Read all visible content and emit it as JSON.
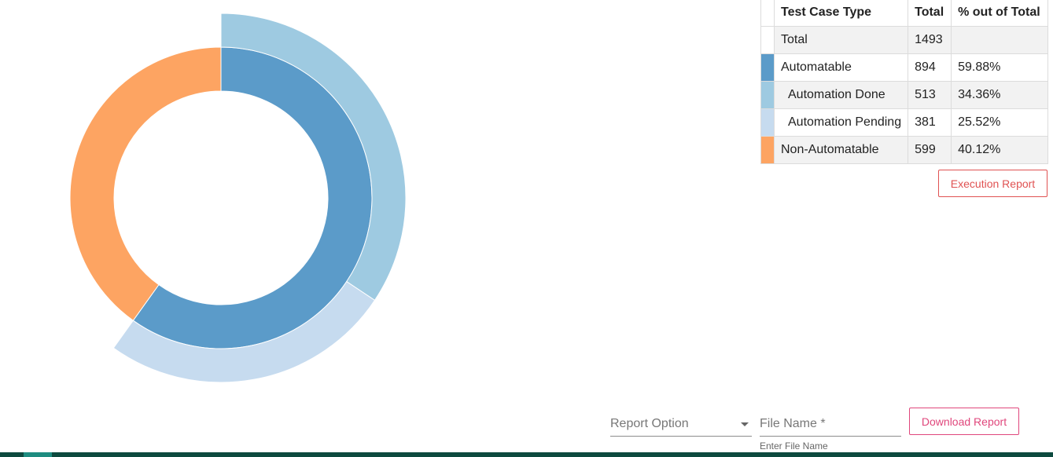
{
  "chart_data": {
    "type": "sunburst",
    "categories": [
      "Automatable",
      "Non-Automatable"
    ],
    "inner_ring": [
      {
        "name": "Automatable",
        "value": 894,
        "color": "#5b9bc9"
      },
      {
        "name": "Non-Automatable",
        "value": 599,
        "color": "#fda462"
      }
    ],
    "outer_ring": [
      {
        "name": "Automation Done",
        "parent": "Automatable",
        "value": 513,
        "color": "#9ecae1"
      },
      {
        "name": "Automation Pending",
        "parent": "Automatable",
        "value": 381,
        "color": "#c6dbef"
      }
    ],
    "total": 1493
  },
  "table": {
    "headers": [
      "Test Case Type",
      "Total",
      "% out of Total"
    ],
    "rows": [
      {
        "label": "Total",
        "total": "1493",
        "pct": "",
        "color": "#ffffff",
        "indent": false,
        "shade": true
      },
      {
        "label": "Automatable",
        "total": "894",
        "pct": "59.88%",
        "color": "#5b9bc9",
        "indent": false,
        "shade": false
      },
      {
        "label": "Automation Done",
        "total": "513",
        "pct": "34.36%",
        "color": "#9ecae1",
        "indent": true,
        "shade": true
      },
      {
        "label": "Automation Pending",
        "total": "381",
        "pct": "25.52%",
        "color": "#c6dbef",
        "indent": true,
        "shade": false
      },
      {
        "label": "Non-Automatable",
        "total": "599",
        "pct": "40.12%",
        "color": "#fda462",
        "indent": false,
        "shade": true
      }
    ]
  },
  "buttons": {
    "execution_report": "Execution Report",
    "download_report": "Download Report"
  },
  "form": {
    "report_option_label": "Report Option",
    "file_name_placeholder": "File Name *",
    "file_name_hint": "Enter File Name"
  }
}
